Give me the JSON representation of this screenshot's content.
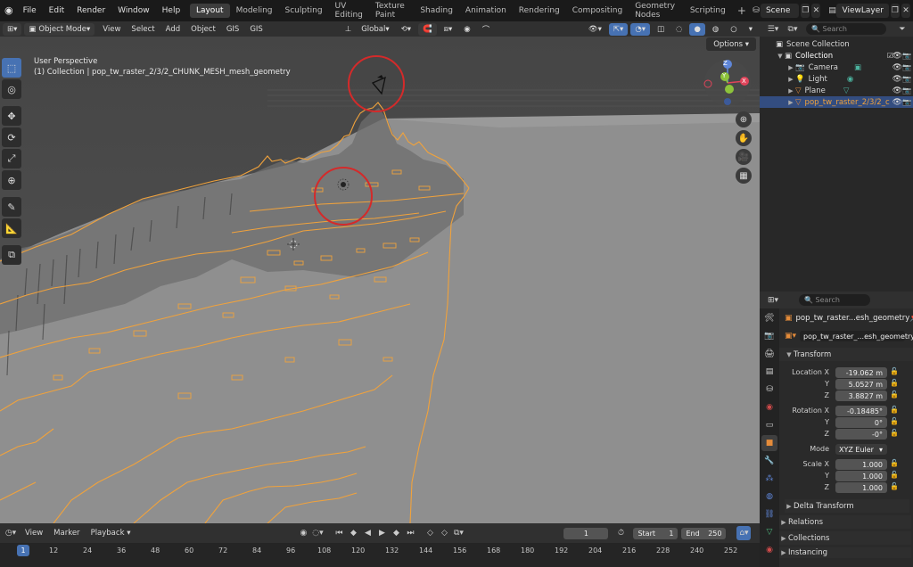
{
  "topbar": {
    "menus": [
      "File",
      "Edit",
      "Render",
      "Window",
      "Help"
    ],
    "workspaces": [
      "Layout",
      "Modeling",
      "Sculpting",
      "UV Editing",
      "Texture Paint",
      "Shading",
      "Animation",
      "Rendering",
      "Compositing",
      "Geometry Nodes",
      "Scripting"
    ],
    "active_workspace": "Layout",
    "scene": "Scene",
    "view_layer": "ViewLayer"
  },
  "viewport_header": {
    "mode": "Object Mode",
    "menus": [
      "View",
      "Select",
      "Add",
      "Object",
      "GIS",
      "GIS"
    ],
    "orientation": "Global",
    "options": "Options"
  },
  "viewport": {
    "perspective": "User Perspective",
    "collection_info": "(1) Collection | pop_tw_raster_2/3/2_CHUNK_MESH_mesh_geometry",
    "gizmo_axes": [
      "Z",
      "Y",
      "X"
    ],
    "colors": {
      "background": "#4f4f4f",
      "terrain": "#8e8e8e",
      "outline": "#f0a23c",
      "annotation": "#d42a2a"
    }
  },
  "outliner": {
    "search_placeholder": "Search",
    "items": [
      {
        "label": "Scene Collection",
        "indent": 0
      },
      {
        "label": "Collection",
        "indent": 1
      },
      {
        "label": "Camera",
        "indent": 2
      },
      {
        "label": "Light",
        "indent": 2
      },
      {
        "label": "Plane",
        "indent": 2
      },
      {
        "label": "pop_tw_raster_2/3/2_c",
        "indent": 2
      }
    ]
  },
  "properties": {
    "search_placeholder": "Search",
    "object_name": "pop_tw_raster...esh_geometry",
    "data_name": "pop_tw_raster_...esh_geometry",
    "transform_label": "Transform",
    "location": {
      "label": "Location X",
      "x": "-19.062 m",
      "y": "5.0527 m",
      "z": "3.8827 m"
    },
    "rotation": {
      "label": "Rotation X",
      "x": "-0.18485°",
      "y": "0°",
      "z": "-0°"
    },
    "mode": {
      "label": "Mode",
      "value": "XYZ Euler"
    },
    "scale": {
      "label": "Scale X",
      "x": "1.000",
      "y": "1.000",
      "z": "1.000"
    },
    "axis_labels": {
      "y": "Y",
      "z": "Z"
    },
    "sections": [
      "Delta Transform",
      "Relations",
      "Collections",
      "Instancing"
    ]
  },
  "timeline": {
    "menus": [
      "View",
      "Marker",
      "Playback"
    ],
    "current_frame": "1",
    "start_label": "Start",
    "start": "1",
    "end_label": "End",
    "end": "250",
    "ruler": [
      "1",
      "12",
      "24",
      "36",
      "48",
      "60",
      "72",
      "84",
      "96",
      "108",
      "120",
      "132",
      "144",
      "156",
      "168",
      "180",
      "192",
      "204",
      "216",
      "228",
      "240",
      "252"
    ]
  }
}
